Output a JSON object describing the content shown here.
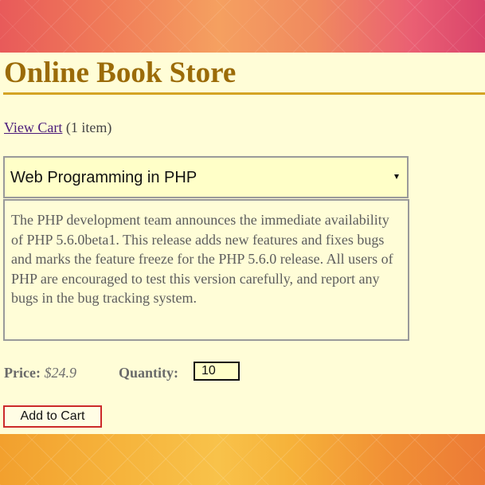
{
  "store": {
    "title": "Online Book Store"
  },
  "cart": {
    "link_label": "View Cart",
    "count_text": "(1 item)"
  },
  "book_select": {
    "selected": "Web Programming in PHP"
  },
  "book": {
    "description": "The PHP development team announces the immediate availability of PHP 5.6.0beta1. This release adds new features and fixes bugs and marks the feature freeze for the PHP 5.6.0 release. All users of PHP are encouraged to test this version carefully, and report any bugs in the bug tracking system."
  },
  "pricing": {
    "price_label": "Price:",
    "price_value": "$24.9",
    "quantity_label": "Quantity:",
    "quantity_value": "10"
  },
  "actions": {
    "add_to_cart_label": "Add to Cart"
  },
  "colors": {
    "title": "#9b6b08",
    "title_rule": "#d4a324",
    "page_background": "#fffdd7",
    "field_background": "#ffffc8",
    "add_button_border": "#cc2a2a"
  }
}
